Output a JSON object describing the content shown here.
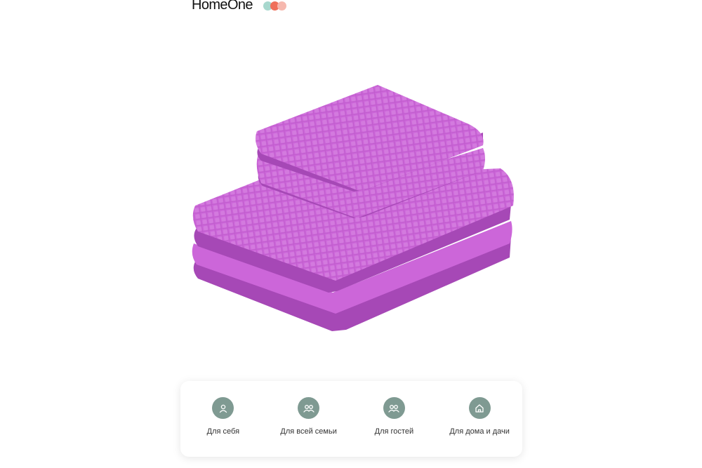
{
  "header": {
    "brand": "HomeOne",
    "trademark": "™",
    "dot_colors": [
      "#a8d8ce",
      "#ef6f5a",
      "#f6b8ae"
    ]
  },
  "product": {
    "color": "#cc66d9",
    "shade_color": "#a648b6"
  },
  "features": {
    "icon_bg": "#7f9a92",
    "items": [
      {
        "label": "Для себя",
        "icon": "person-icon"
      },
      {
        "label": "Для всей семьи",
        "icon": "group-icon"
      },
      {
        "label": "Для гостей",
        "icon": "group-icon"
      },
      {
        "label": "Для дома и дачи",
        "icon": "home-icon"
      }
    ]
  }
}
